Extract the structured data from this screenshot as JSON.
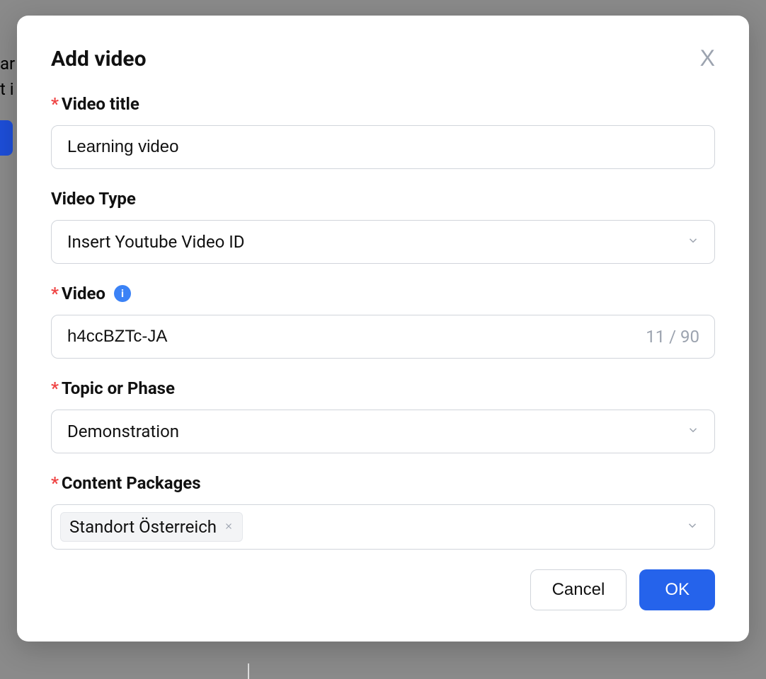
{
  "background": {
    "text_fragment1": "ar",
    "text_fragment2": "t i"
  },
  "modal": {
    "title": "Add video",
    "fields": {
      "video_title": {
        "label": "Video title",
        "value": "Learning video",
        "required": true
      },
      "video_type": {
        "label": "Video Type",
        "value": "Insert Youtube Video ID",
        "required": false
      },
      "video": {
        "label": "Video",
        "value": "h4ccBZTc-JA",
        "counter": "11 / 90",
        "required": true,
        "has_info": true
      },
      "topic_phase": {
        "label": "Topic or Phase",
        "value": "Demonstration",
        "required": true
      },
      "content_packages": {
        "label": "Content Packages",
        "required": true,
        "tags": [
          "Standort Österreich"
        ]
      }
    },
    "buttons": {
      "cancel": "Cancel",
      "ok": "OK"
    }
  }
}
